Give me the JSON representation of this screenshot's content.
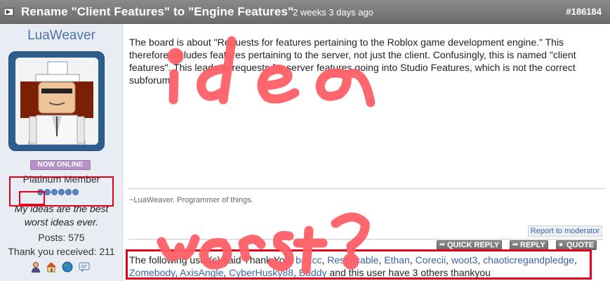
{
  "post": {
    "title": "Rename \"Client Features\" to \"Engine Features\"",
    "date": "2 weeks 3 days ago",
    "number": "#186184",
    "body": "The board is about \"Requests for features pertaining to the Roblox game development engine.\" This therefore includes features pertaining to the server, not just the client. Confusingly, this is named \"client features\". This leads to requests for server features going into Studio Features, which is not the correct subforum.",
    "signature": "~LuaWeaver. Programmer of things."
  },
  "user": {
    "name": "LuaWeaver",
    "status": "NOW ONLINE",
    "rank": "Platinum Member",
    "stars": 6,
    "tagline_line1": "My ideas are the best",
    "tagline_word": "worst",
    "tagline_rest": " ideas ever.",
    "posts": "Posts: 575",
    "thanks_received": "Thank you received: 211",
    "icons": [
      "user-icon",
      "home-icon",
      "globe-icon",
      "message-icon"
    ]
  },
  "actions": {
    "report": "Report to moderator",
    "quick_reply": "QUICK REPLY",
    "reply": "REPLY",
    "quote": "QUOTE"
  },
  "thanks": {
    "prefix": "The following user(s) said Thank You: ",
    "users": [
      "badcc",
      "Resyncable",
      "Ethan",
      "Corecii",
      "woot3",
      "chaoticregandpledge",
      "Zomebody",
      "AxisAngle",
      "CyberHusky88",
      "Buddy"
    ],
    "suffix": " and this user have 3 others thankyou"
  },
  "annotations": {
    "color": "#ff5f68",
    "highlight_color": "#e4001a"
  }
}
